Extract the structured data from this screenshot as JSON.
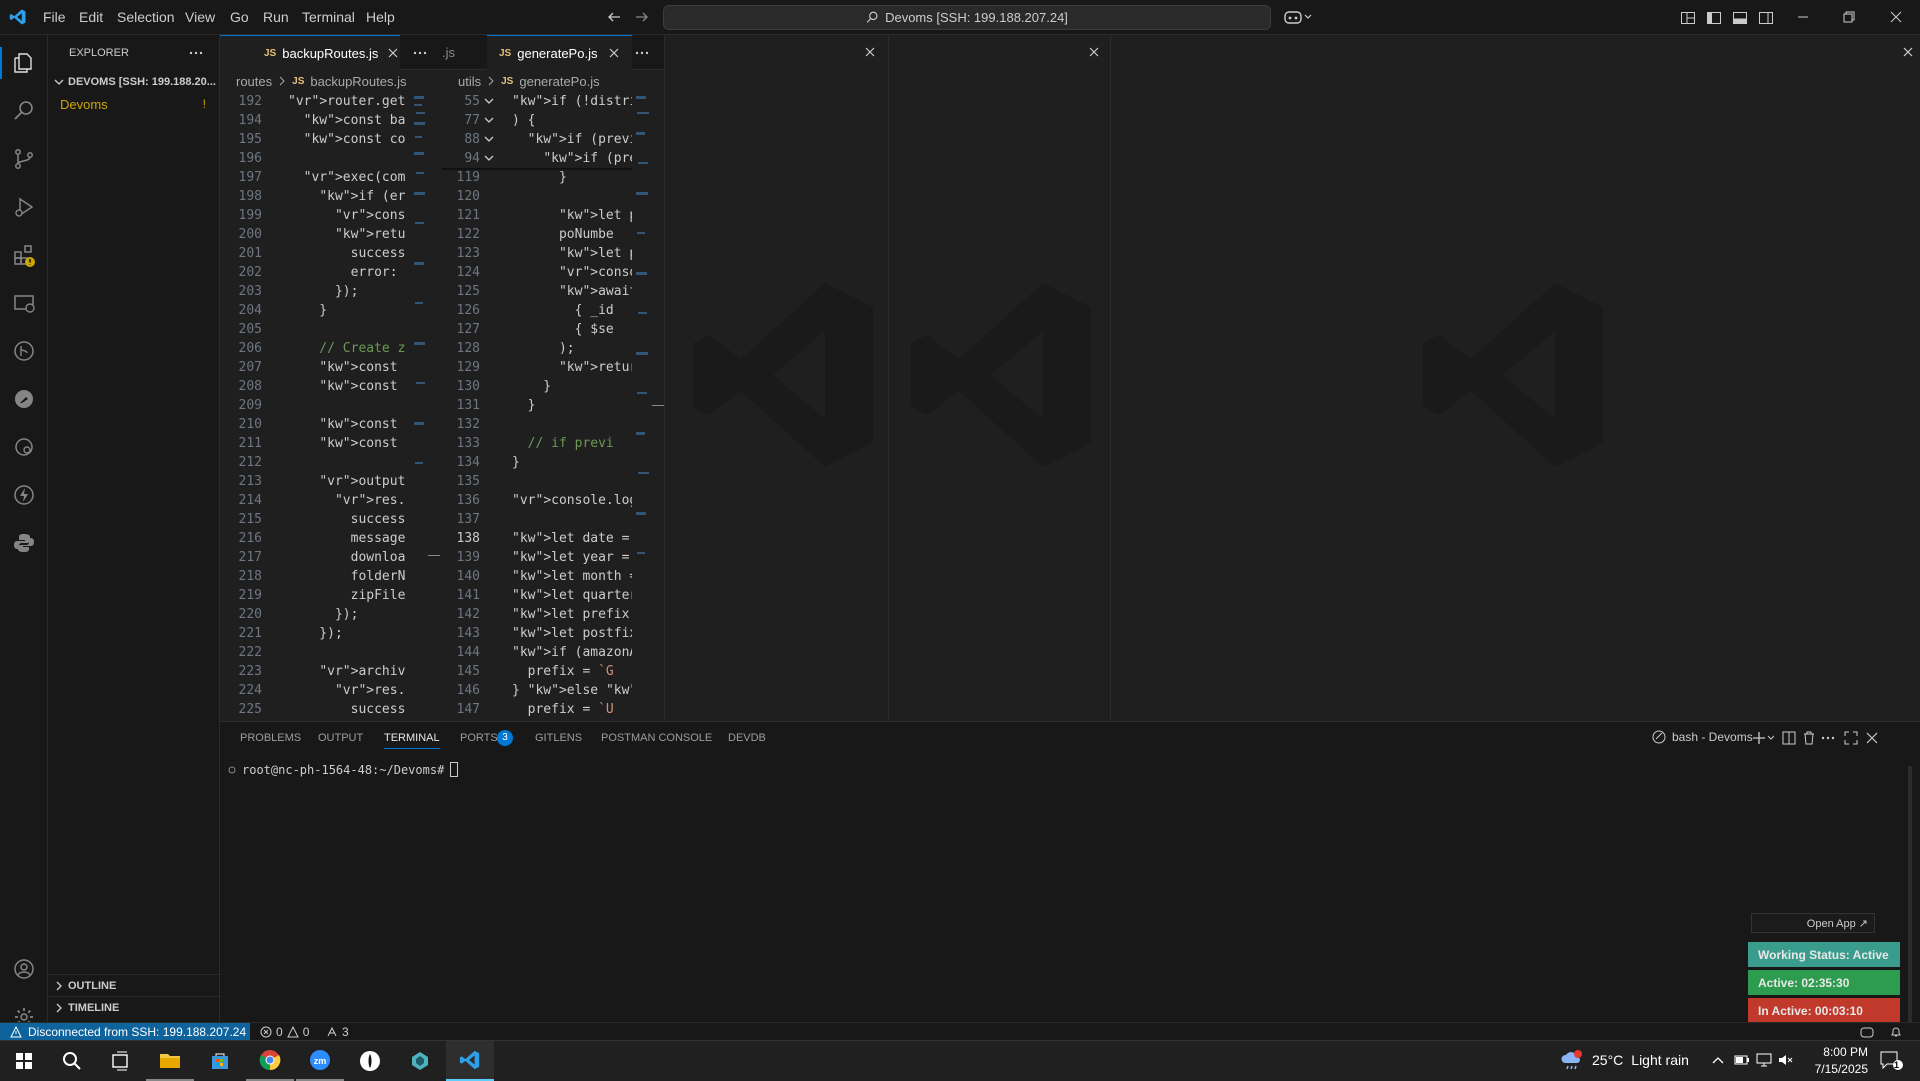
{
  "menu": [
    "File",
    "Edit",
    "Selection",
    "View",
    "Go",
    "Run",
    "Terminal",
    "Help"
  ],
  "command_center": "Devoms [SSH: 199.188.207.24]",
  "sidebar": {
    "title": "EXPLORER",
    "root": "DEVOMS [SSH: 199.188.20...",
    "folder": "Devoms",
    "folder_badge": "!",
    "outline": "OUTLINE",
    "timeline": "TIMELINE"
  },
  "group1": {
    "tab_label": "backupRoutes.js",
    "crumb_folder": "routes",
    "crumb_file": "backupRoutes.js",
    "lines": [
      {
        "n": "192",
        "t": "router.get('/tr"
      },
      {
        "n": "194",
        "t": "  const backupP"
      },
      {
        "n": "195",
        "t": "  const command"
      },
      {
        "n": "196",
        "t": ""
      },
      {
        "n": "197",
        "t": "  exec(command,"
      },
      {
        "n": "198",
        "t": "    if (error |"
      },
      {
        "n": "199",
        "t": "      console.e"
      },
      {
        "n": "200",
        "t": "      return re"
      },
      {
        "n": "201",
        "t": "        success"
      },
      {
        "n": "202",
        "t": "        error:"
      },
      {
        "n": "203",
        "t": "      });"
      },
      {
        "n": "204",
        "t": "    }"
      },
      {
        "n": "205",
        "t": ""
      },
      {
        "n": "206",
        "t": "    // Create z"
      },
      {
        "n": "207",
        "t": "    const zipFi"
      },
      {
        "n": "208",
        "t": "    const zipFi"
      },
      {
        "n": "209",
        "t": ""
      },
      {
        "n": "210",
        "t": "    const outpu"
      },
      {
        "n": "211",
        "t": "    const archi"
      },
      {
        "n": "212",
        "t": ""
      },
      {
        "n": "213",
        "t": "    output.on('"
      },
      {
        "n": "214",
        "t": "      res.json("
      },
      {
        "n": "215",
        "t": "        success"
      },
      {
        "n": "216",
        "t": "        message"
      },
      {
        "n": "217",
        "t": "        downloa"
      },
      {
        "n": "218",
        "t": "        folderN"
      },
      {
        "n": "219",
        "t": "        zipFile"
      },
      {
        "n": "220",
        "t": "      });"
      },
      {
        "n": "221",
        "t": "    });"
      },
      {
        "n": "222",
        "t": ""
      },
      {
        "n": "223",
        "t": "    archive.on("
      },
      {
        "n": "224",
        "t": "      res.statu"
      },
      {
        "n": "225",
        "t": "        success"
      }
    ]
  },
  "group2": {
    "tab_partial": ".js",
    "tab_label": "generatePo.js",
    "crumb_folder": "utils",
    "crumb_file": "generatePo.js",
    "sticky": [
      {
        "n": "55",
        "t": "if (!distributo"
      },
      {
        "n": "77",
        "t": ") {"
      },
      {
        "n": "88",
        "t": "  if (previou"
      },
      {
        "n": "94",
        "t": "    if (previ"
      }
    ],
    "lines": [
      {
        "n": "119",
        "t": "      }"
      },
      {
        "n": "120",
        "t": ""
      },
      {
        "n": "121",
        "t": "      let poN"
      },
      {
        "n": "122",
        "t": "      poNumbe"
      },
      {
        "n": "123",
        "t": "      let poN"
      },
      {
        "n": "124",
        "t": "      console"
      },
      {
        "n": "125",
        "t": "      await O"
      },
      {
        "n": "126",
        "t": "        { _id"
      },
      {
        "n": "127",
        "t": "        { $se"
      },
      {
        "n": "128",
        "t": "      );"
      },
      {
        "n": "129",
        "t": "      return"
      },
      {
        "n": "130",
        "t": "    }"
      },
      {
        "n": "131",
        "t": "  }"
      },
      {
        "n": "132",
        "t": ""
      },
      {
        "n": "133",
        "t": "  // if previ"
      },
      {
        "n": "134",
        "t": "}"
      },
      {
        "n": "135",
        "t": ""
      },
      {
        "n": "136",
        "t": "console.log(\""
      },
      {
        "n": "137",
        "t": ""
      },
      {
        "n": "138",
        "t": "let date = ne"
      },
      {
        "n": "139",
        "t": "let year = da"
      },
      {
        "n": "140",
        "t": "let month = d"
      },
      {
        "n": "141",
        "t": "let quarter ="
      },
      {
        "n": "142",
        "t": "let prefix ="
      },
      {
        "n": "143",
        "t": "let postfix ="
      },
      {
        "n": "144",
        "t": "if (amazonAcc"
      },
      {
        "n": "145",
        "t": "  prefix = `G"
      },
      {
        "n": "146",
        "t": "} else if (am"
      },
      {
        "n": "147",
        "t": "  prefix = `U"
      }
    ]
  },
  "panel": {
    "tabs": [
      "PROBLEMS",
      "OUTPUT",
      "TERMINAL",
      "PORTS",
      "GITLENS",
      "POSTMAN CONSOLE",
      "DEVDB"
    ],
    "ports_badge": "3",
    "terminal_name": "bash - Devoms",
    "prompt": "root@nc-ph-1564-48:~/Devoms#"
  },
  "status": {
    "remote": "Disconnected from SSH: 199.188.207.24",
    "errors": "0",
    "warnings": "0",
    "ports": "3"
  },
  "widget": {
    "open_app": "Open App ↗",
    "working": "Working Status: Active",
    "active": "Active: 02:35:30",
    "inactive": "In Active: 00:03:10"
  },
  "taskbar": {
    "weather_temp": "25°C",
    "weather_desc": "Light rain",
    "time": "8:00 PM",
    "date": "7/15/2025",
    "notif_count": "1"
  },
  "colors": {
    "accent": "#0078d4",
    "status_remote_bg": "#0e639c",
    "working_bg": "#3a9c8c",
    "active_bg": "#2e9c4e",
    "inactive_bg": "#c0392b"
  }
}
